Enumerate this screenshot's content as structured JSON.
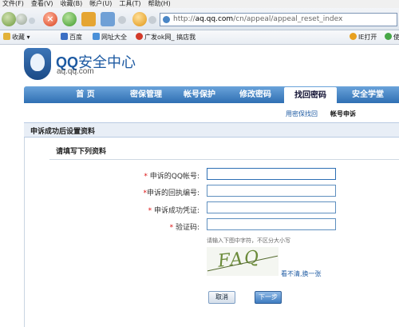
{
  "browser": {
    "menu": [
      "文件(F)",
      "查看(V)",
      "收藏(B)",
      "帐户(U)",
      "工具(T)",
      "帮助(H)"
    ],
    "address": {
      "prefix": "http://",
      "host": "aq.qq.com",
      "path": "/cn/appeal/appeal_reset_index"
    },
    "favorites": {
      "star_label": "收藏",
      "items": [
        "百度",
        "网址大全",
        "广发ok网_ 搞店我"
      ],
      "right_items": [
        "IE打开",
        "使"
      ]
    }
  },
  "site": {
    "logo_title_bold": "QQ",
    "logo_title_rest": "安全中心",
    "logo_sub": "aq.qq.com"
  },
  "nav": {
    "tabs": [
      "首 页",
      "密保管理",
      "帐号保护",
      "修改密码",
      "找回密码",
      "安全学堂"
    ],
    "active_tab": "找回密码",
    "sub": [
      "用密保找回",
      "帐号申诉"
    ]
  },
  "section": {
    "title": "申诉成功后设置资料",
    "subtitle": "请填写下列资料"
  },
  "form": {
    "fields": [
      {
        "label": "申诉的QQ帐号:",
        "value": ""
      },
      {
        "label": "申诉的回执编号:",
        "value": ""
      },
      {
        "label": "申诉成功凭证:",
        "value": ""
      },
      {
        "label": "验证码:",
        "value": ""
      }
    ],
    "required_mark": "*",
    "captcha_hint": "请输入下图中字符，不区分大小写",
    "captcha_text": "FAQ",
    "refresh_link": "看不清,换一张",
    "cancel_label": "取消",
    "next_label": "下一步"
  }
}
